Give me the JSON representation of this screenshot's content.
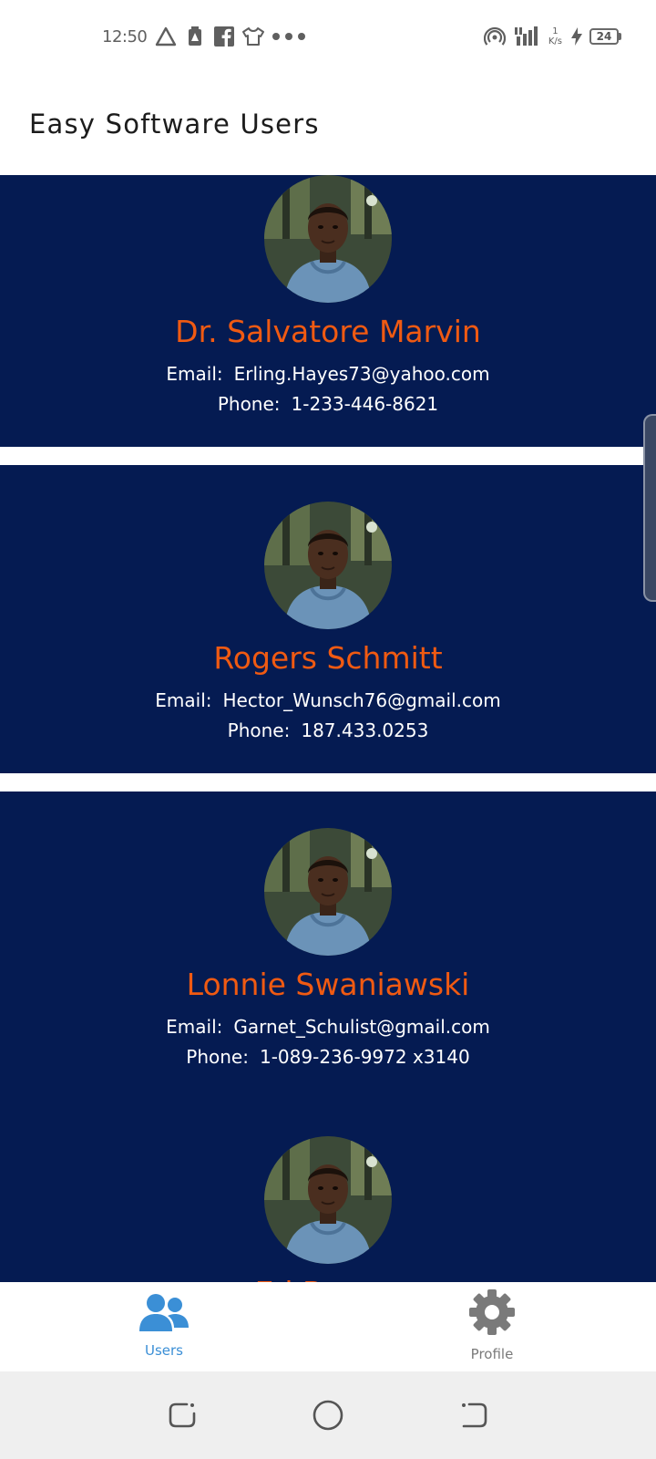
{
  "status_bar": {
    "time": "12:50",
    "speed_value": "1",
    "speed_unit": "K/s",
    "battery": "24"
  },
  "app_bar": {
    "title": "Easy Software Users"
  },
  "users": [
    {
      "name": "Dr. Salvatore Marvin",
      "email_label": "Email:",
      "email": "Erling.Hayes73@yahoo.com",
      "phone_label": "Phone:",
      "phone": "1-233-446-8621"
    },
    {
      "name": "Rogers Schmitt",
      "email_label": "Email:",
      "email": "Hector_Wunsch76@gmail.com",
      "phone_label": "Phone:",
      "phone": "187.433.0253"
    },
    {
      "name": "Lonnie Swaniawski",
      "email_label": "Email:",
      "email": "Garnet_Schulist@gmail.com",
      "phone_label": "Phone:",
      "phone": "1-089-236-9972 x3140"
    },
    {
      "name": "Ed Berg...",
      "email_label": "Email:",
      "email": "",
      "phone_label": "Phone:",
      "phone": ""
    }
  ],
  "bottom_nav": {
    "items": [
      {
        "label": "Users",
        "icon": "users-icon",
        "active": true
      },
      {
        "label": "Profile",
        "icon": "gear-icon",
        "active": false
      }
    ]
  },
  "colors": {
    "card_background": "#051b52",
    "name_accent": "#f05a12",
    "active_tab": "#3b8fd6",
    "inactive_tab": "#7a7a7a"
  }
}
